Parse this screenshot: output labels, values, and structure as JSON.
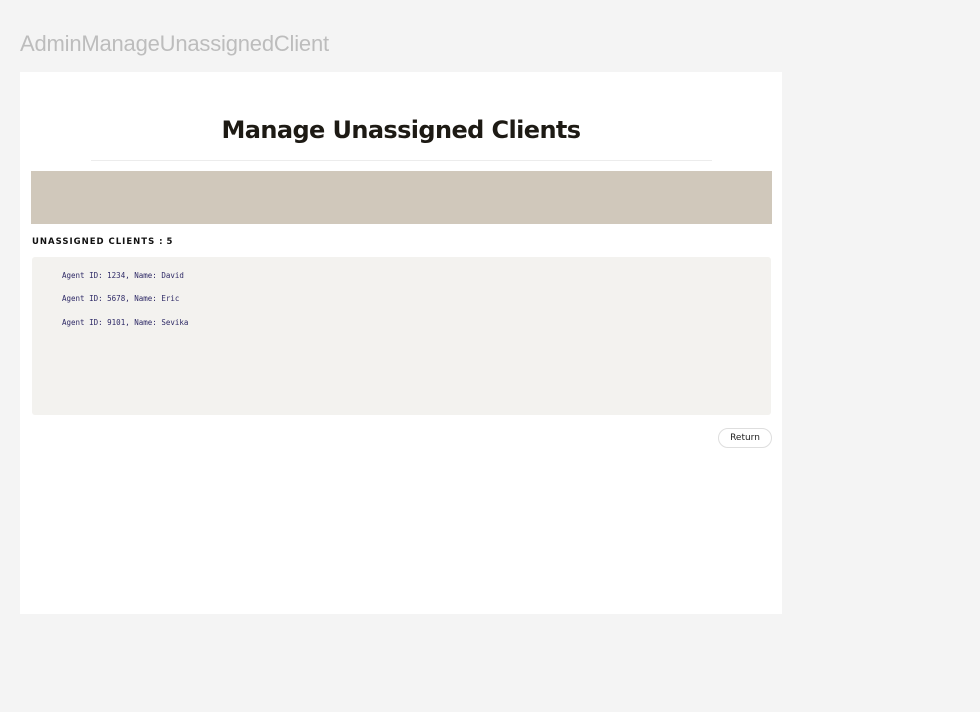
{
  "frame": {
    "name": "AdminManageUnassignedClient"
  },
  "page": {
    "title": "Manage Unassigned Clients",
    "count_label": "UNASSIGNED CLIENTS :",
    "count_value": "5",
    "clients": [
      "Agent ID: 1234, Name: David",
      "Agent ID: 5678, Name: Eric",
      "Agent ID: 9101, Name: Sevika"
    ],
    "return_label": "Return"
  },
  "colors": {
    "banner": "#d0c8bb",
    "panel": "#f3f2ef",
    "item_text": "#2e2a66"
  }
}
